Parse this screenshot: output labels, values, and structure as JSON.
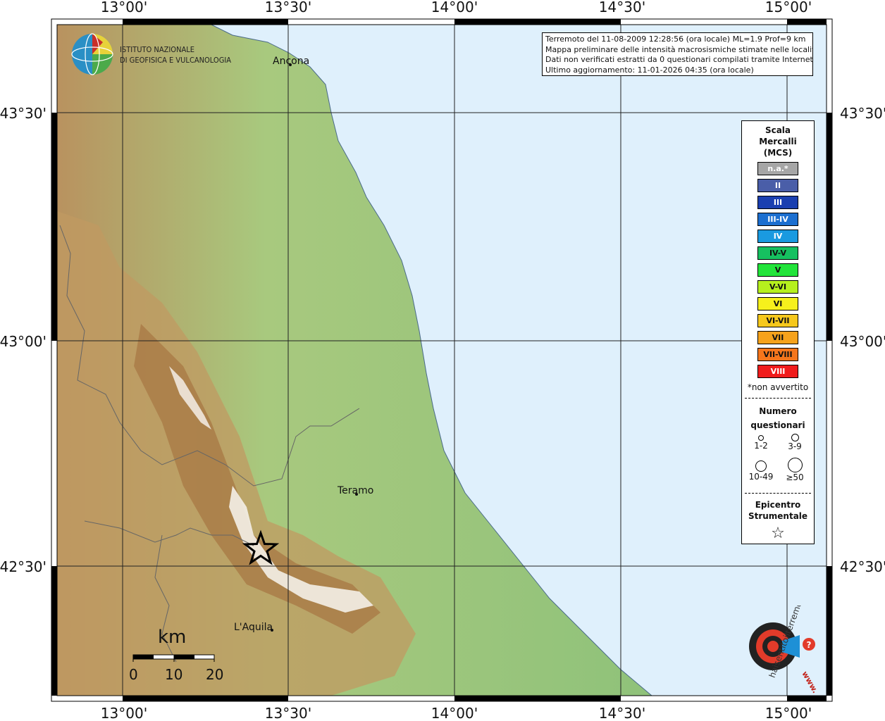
{
  "map": {
    "lon_labels": [
      "13°00'",
      "13°30'",
      "14°00'",
      "14°30'",
      "15°00'"
    ],
    "lat_labels": [
      "43°30'",
      "43°00'",
      "42°30'"
    ],
    "cities": [
      {
        "name": "Ancona"
      },
      {
        "name": "Teramo"
      },
      {
        "name": "L'Aquila"
      }
    ],
    "colors": {
      "sea": "#dff0fc",
      "lowland": "#8fc27a",
      "hills": "#c9a46c",
      "mountains": "#b7854f",
      "peaks": "#f2ede6"
    }
  },
  "logo": {
    "line1": "ISTITUTO NAZIONALE",
    "line2": "DI GEOFISICA E VULCANOLOGIA"
  },
  "info": {
    "line1": "Terremoto del 11-08-2009 12:28:56 (ora locale) ML=1.9 Prof=9 km",
    "line2": "Mappa preliminare delle intensità macrosismiche stimate nelle località",
    "line3": "Dati non verificati estratti da 0 questionari compilati tramite Internet.",
    "line4": "Ultimo aggiornamento: 11-01-2026 04:35 (ora locale)"
  },
  "legend": {
    "title_line1": "Scala",
    "title_line2": "Mercalli",
    "title_line3": "(MCS)",
    "items": [
      {
        "label": "n.a.*",
        "color": "#a6a6a6",
        "text_color": "#ffffff"
      },
      {
        "label": "II",
        "color": "#4a5ea8",
        "text_color": "#ffffff"
      },
      {
        "label": "III",
        "color": "#1a3fb0",
        "text_color": "#ffffff"
      },
      {
        "label": "III-IV",
        "color": "#1c6fd0",
        "text_color": "#ffffff"
      },
      {
        "label": "IV",
        "color": "#1a9ae0",
        "text_color": "#ffffff"
      },
      {
        "label": "IV-V",
        "color": "#16c060",
        "text_color": "#111111"
      },
      {
        "label": "V",
        "color": "#22e43a",
        "text_color": "#111111"
      },
      {
        "label": "V-VI",
        "color": "#b6f01e",
        "text_color": "#111111"
      },
      {
        "label": "VI",
        "color": "#f6f01c",
        "text_color": "#111111"
      },
      {
        "label": "VI-VII",
        "color": "#f6c81c",
        "text_color": "#111111"
      },
      {
        "label": "VII",
        "color": "#f6a21c",
        "text_color": "#111111"
      },
      {
        "label": "VII-VIII",
        "color": "#f6761c",
        "text_color": "#111111"
      },
      {
        "label": "VIII",
        "color": "#f01c1c",
        "text_color": "#ffffff"
      }
    ],
    "note": "*non avvertito",
    "questionnaires_title_line1": "Numero",
    "questionnaires_title_line2": "questionari",
    "q_labels": [
      "1-2",
      "3-9",
      "10-49",
      "≥50"
    ],
    "epicenter_title_line1": "Epicentro",
    "epicenter_title_line2": "Strumentale",
    "epicenter_symbol": "☆"
  },
  "scalebar": {
    "unit": "km",
    "ticks": [
      "0",
      "10",
      "20"
    ]
  },
  "brand": {
    "text": "haisentitoilterremoto.it",
    "www": "www."
  }
}
